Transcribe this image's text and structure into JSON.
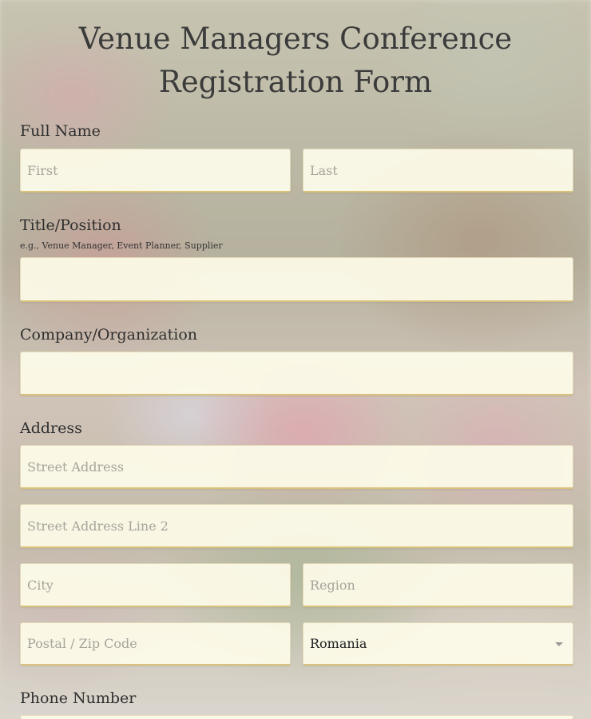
{
  "form": {
    "title_line1": "Venue Managers Conference",
    "title_line2": "Registration Form",
    "full_name": {
      "label": "Full Name",
      "first_placeholder": "First",
      "last_placeholder": "Last"
    },
    "title_position": {
      "label": "Title/Position",
      "hint": "e.g., Venue Manager, Event Planner, Supplier",
      "value": ""
    },
    "company": {
      "label": "Company/Organization",
      "value": ""
    },
    "address": {
      "label": "Address",
      "street_placeholder": "Street Address",
      "street2_placeholder": "Street Address Line 2",
      "city_placeholder": "City",
      "region_placeholder": "Region",
      "postal_placeholder": "Postal / Zip Code",
      "country_value": "Romania"
    },
    "phone": {
      "label": "Phone Number"
    }
  },
  "icons": {
    "country_dropdown": "chevron-down-icon"
  },
  "colors": {
    "field_background": "#fdfbe8",
    "field_underline": "#d9c27a",
    "title_text": "#3b3b3b"
  }
}
